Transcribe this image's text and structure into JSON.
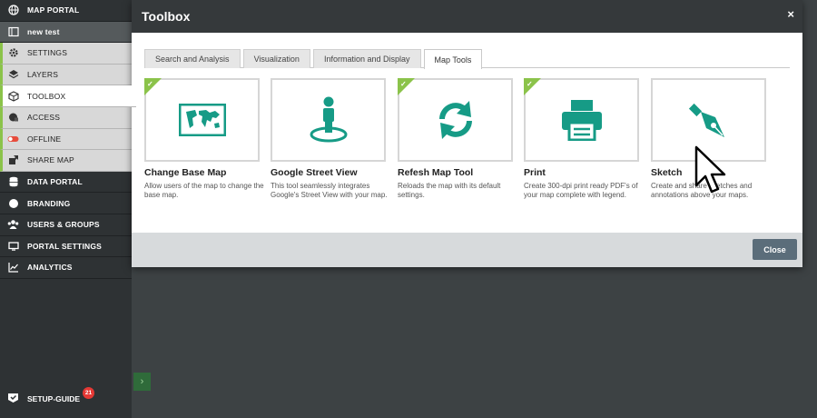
{
  "sidebar": {
    "items": [
      {
        "label": "MAP PORTAL",
        "icon": "globe-icon"
      },
      {
        "label": "new test",
        "icon": "map-frame-icon"
      },
      {
        "label": "SETTINGS",
        "icon": "gear-icon"
      },
      {
        "label": "LAYERS",
        "icon": "layers-icon"
      },
      {
        "label": "TOOLBOX",
        "icon": "cube-icon"
      },
      {
        "label": "ACCESS",
        "icon": "lock-globe-icon"
      },
      {
        "label": "OFFLINE",
        "icon": "toggle-icon"
      },
      {
        "label": "SHARE MAP",
        "icon": "share-icon"
      },
      {
        "label": "DATA PORTAL",
        "icon": "database-icon"
      },
      {
        "label": "BRANDING",
        "icon": "badge-icon"
      },
      {
        "label": "USERS & GROUPS",
        "icon": "users-icon"
      },
      {
        "label": "PORTAL SETTINGS",
        "icon": "monitor-icon"
      },
      {
        "label": "ANALYTICS",
        "icon": "chart-line-icon"
      }
    ],
    "setup_guide": {
      "label": "SETUP-GUIDE",
      "badge": "21"
    }
  },
  "dialog": {
    "title": "Toolbox",
    "close_icon": "×",
    "tabs": [
      {
        "label": "Search and Analysis"
      },
      {
        "label": "Visualization"
      },
      {
        "label": "Information and Display"
      },
      {
        "label": "Map Tools"
      }
    ],
    "active_tab": "Map Tools",
    "cards": [
      {
        "title": "Change Base Map",
        "desc": "Allow users of the map to change the base map.",
        "enabled": true,
        "icon": "world-map-icon"
      },
      {
        "title": "Google Street View",
        "desc": "This tool seamlessly integrates Google's Street View with your map.",
        "enabled": false,
        "icon": "street-view-person-icon"
      },
      {
        "title": "Refesh Map Tool",
        "desc": "Reloads the map with its default settings.",
        "enabled": true,
        "icon": "refresh-icon"
      },
      {
        "title": "Print",
        "desc": "Create 300-dpi print ready PDF's of your map complete with legend.",
        "enabled": true,
        "icon": "printer-icon"
      },
      {
        "title": "Sketch",
        "desc": "Create and share sketches and annotations above your maps.",
        "enabled": false,
        "icon": "pen-nib-icon"
      }
    ],
    "close_button": "Close"
  },
  "colors": {
    "accent": "#169b86",
    "check": "#8bc34a",
    "sidebar": "#2e3234"
  }
}
